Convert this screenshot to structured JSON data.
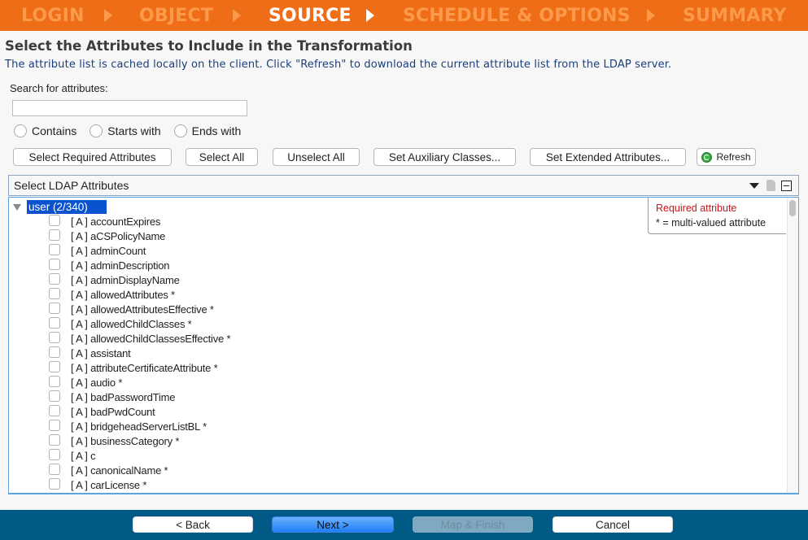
{
  "wizard": {
    "steps": [
      {
        "label": "LOGIN",
        "active": false
      },
      {
        "label": "OBJECT",
        "active": false
      },
      {
        "label": "SOURCE",
        "active": true
      },
      {
        "label": "SCHEDULE & OPTIONS",
        "active": false
      },
      {
        "label": "SUMMARY",
        "active": false
      }
    ],
    "colors": {
      "bar": "#f06d17",
      "inactive": "#fb9a4b",
      "active": "#ffffff"
    }
  },
  "page": {
    "title": "Select the Attributes to Include in the Transformation",
    "subtitle": "The attribute list is cached locally on the client. Click \"Refresh\" to download the current attribute list from the LDAP server."
  },
  "search": {
    "label": "Search for attributes:",
    "value": "",
    "placeholder": "",
    "match_options": [
      {
        "label": "Contains",
        "selected": false
      },
      {
        "label": "Starts with",
        "selected": false
      },
      {
        "label": "Ends with",
        "selected": false
      }
    ]
  },
  "actions": {
    "select_required": "Select Required Attributes",
    "select_all": "Select All",
    "unselect_all": "Unselect All",
    "set_auxiliary": "Set Auxiliary Classes...",
    "set_extended": "Set Extended Attributes...",
    "refresh": "Refresh"
  },
  "panel": {
    "title": "Select LDAP Attributes",
    "root": {
      "label": "user (2/340)",
      "expanded": true,
      "selected": true
    },
    "legend": {
      "required": "Required attribute",
      "multi": "* = multi-valued attribute",
      "required_color": "#c8151b"
    },
    "attributes": [
      {
        "text": "[ A ] accountExpires",
        "checked": false
      },
      {
        "text": "[ A ] aCSPolicyName",
        "checked": false
      },
      {
        "text": "[ A ] adminCount",
        "checked": false
      },
      {
        "text": "[ A ] adminDescription",
        "checked": false
      },
      {
        "text": "[ A ] adminDisplayName",
        "checked": false
      },
      {
        "text": "[ A ] allowedAttributes *",
        "checked": false
      },
      {
        "text": "[ A ] allowedAttributesEffective *",
        "checked": false
      },
      {
        "text": "[ A ] allowedChildClasses *",
        "checked": false
      },
      {
        "text": "[ A ] allowedChildClassesEffective *",
        "checked": false
      },
      {
        "text": "[ A ] assistant",
        "checked": false
      },
      {
        "text": "[ A ] attributeCertificateAttribute *",
        "checked": false
      },
      {
        "text": "[ A ] audio *",
        "checked": false
      },
      {
        "text": "[ A ] badPasswordTime",
        "checked": false
      },
      {
        "text": "[ A ] badPwdCount",
        "checked": false
      },
      {
        "text": "[ A ] bridgeheadServerListBL *",
        "checked": false
      },
      {
        "text": "[ A ] businessCategory *",
        "checked": false
      },
      {
        "text": "[ A ] c",
        "checked": false
      },
      {
        "text": "[ A ] canonicalName *",
        "checked": false
      },
      {
        "text": "[ A ] carLicense *",
        "checked": false
      },
      {
        "text": "",
        "checked": false
      }
    ]
  },
  "footer": {
    "back": "< Back",
    "next": "Next >",
    "map_finish": "Map & Finish",
    "map_finish_enabled": false,
    "cancel": "Cancel",
    "color": "#005a85"
  }
}
